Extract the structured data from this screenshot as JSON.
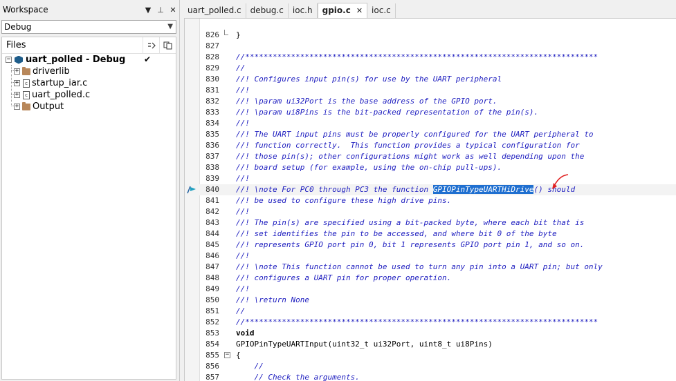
{
  "workspace": {
    "title": "Workspace",
    "header_buttons": [
      "▼",
      "⊥",
      "✕"
    ],
    "config": "Debug",
    "files_label": "Files",
    "col1_icon": "≈̃",
    "col2_icon": "⎘",
    "project": "uart_polled - Debug",
    "project_check": "✔",
    "items": [
      {
        "name": "driverlib",
        "type": "folder"
      },
      {
        "name": "startup_iar.c",
        "type": "file"
      },
      {
        "name": "uart_polled.c",
        "type": "file"
      },
      {
        "name": "Output",
        "type": "folder"
      }
    ]
  },
  "tabs": [
    {
      "label": "uart_polled.c"
    },
    {
      "label": "debug.c"
    },
    {
      "label": "ioc.h"
    },
    {
      "label": "gpio.c",
      "active": true,
      "close": "✕"
    },
    {
      "label": "ioc.c"
    }
  ],
  "editor": {
    "lines": [
      {
        "n": "826",
        "fold": "end",
        "text": "}",
        "style": "text"
      },
      {
        "n": "827",
        "text": "",
        "style": "text"
      },
      {
        "n": "828",
        "text": "//*****************************************************************************",
        "style": "comment"
      },
      {
        "n": "829",
        "text": "//",
        "style": "comment"
      },
      {
        "n": "830",
        "text": "//! Configures input pin(s) for use by the UART peripheral",
        "style": "comment"
      },
      {
        "n": "831",
        "text": "//!",
        "style": "comment"
      },
      {
        "n": "832",
        "text": "//! \\param ui32Port is the base address of the GPIO port.",
        "style": "comment"
      },
      {
        "n": "833",
        "text": "//! \\param ui8Pins is the bit-packed representation of the pin(s).",
        "style": "comment"
      },
      {
        "n": "834",
        "text": "//!",
        "style": "comment"
      },
      {
        "n": "835",
        "text": "//! The UART input pins must be properly configured for the UART peripheral to",
        "style": "comment"
      },
      {
        "n": "836",
        "text": "//! function correctly.  This function provides a typical configuration for",
        "style": "comment"
      },
      {
        "n": "837",
        "text": "//! those pin(s); other configurations might work as well depending upon the",
        "style": "comment"
      },
      {
        "n": "838",
        "text": "//! board setup (for example, using the on-chip pull-ups).",
        "style": "comment"
      },
      {
        "n": "839",
        "text": "//!",
        "style": "comment"
      },
      {
        "n": "840",
        "pre": "//! \\note For PC0 through PC3 the function ",
        "hl": "GPIOPinTypeUARTHiDrive",
        "post": "() should",
        "style": "comment",
        "current": true
      },
      {
        "n": "841",
        "text": "//! be used to configure these high drive pins.",
        "style": "comment"
      },
      {
        "n": "842",
        "text": "//!",
        "style": "comment"
      },
      {
        "n": "843",
        "text": "//! The pin(s) are specified using a bit-packed byte, where each bit that is",
        "style": "comment"
      },
      {
        "n": "844",
        "text": "//! set identifies the pin to be accessed, and where bit 0 of the byte",
        "style": "comment"
      },
      {
        "n": "845",
        "text": "//! represents GPIO port pin 0, bit 1 represents GPIO port pin 1, and so on.",
        "style": "comment"
      },
      {
        "n": "846",
        "text": "//!",
        "style": "comment"
      },
      {
        "n": "847",
        "text": "//! \\note This function cannot be used to turn any pin into a UART pin; but only",
        "style": "comment"
      },
      {
        "n": "848",
        "text": "//! configures a UART pin for proper operation.",
        "style": "comment"
      },
      {
        "n": "849",
        "text": "//!",
        "style": "comment"
      },
      {
        "n": "850",
        "text": "//! \\return None",
        "style": "comment"
      },
      {
        "n": "851",
        "text": "//",
        "style": "comment"
      },
      {
        "n": "852",
        "text": "//*****************************************************************************",
        "style": "comment"
      },
      {
        "n": "853",
        "text": "void",
        "style": "kw"
      },
      {
        "n": "854",
        "text": "GPIOPinTypeUARTInput(uint32_t ui32Port, uint8_t ui8Pins)",
        "style": "text"
      },
      {
        "n": "855",
        "fold": "box",
        "text": "{",
        "style": "text"
      },
      {
        "n": "856",
        "text": "    //",
        "style": "comment"
      },
      {
        "n": "857",
        "text": "    // Check the arguments.",
        "style": "comment"
      }
    ]
  }
}
